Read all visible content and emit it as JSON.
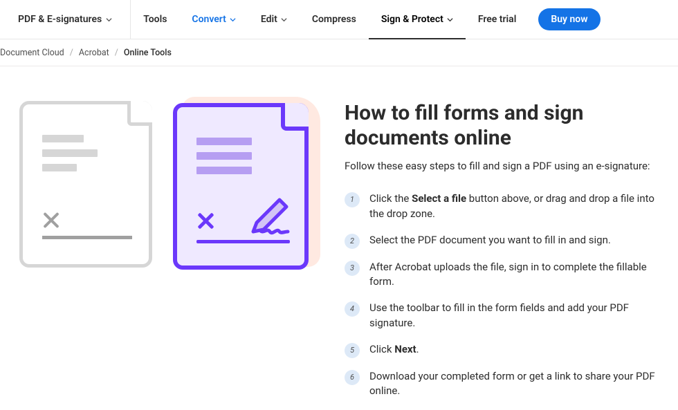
{
  "nav": {
    "category": "PDF & E-signatures",
    "items": [
      {
        "label": "Tools",
        "dropdown": false
      },
      {
        "label": "Convert",
        "dropdown": true,
        "highlight": true
      },
      {
        "label": "Edit",
        "dropdown": true
      },
      {
        "label": "Compress",
        "dropdown": false
      },
      {
        "label": "Sign & Protect",
        "dropdown": true,
        "active": true
      },
      {
        "label": "Free trial",
        "dropdown": false
      }
    ],
    "buy": "Buy now"
  },
  "breadcrumbs": [
    "Document Cloud",
    "Acrobat",
    "Online Tools"
  ],
  "heading": "How to fill forms and sign documents online",
  "subheading": "Follow these easy steps to fill and sign a PDF using an e-signature:",
  "steps": [
    {
      "pre": "Click the ",
      "bold": "Select a file",
      "post": " button above, or drag and drop a file into the drop zone."
    },
    {
      "pre": "Select the PDF document you want to fill in and sign.",
      "bold": "",
      "post": ""
    },
    {
      "pre": "After Acrobat uploads the file, sign in to complete the fillable form.",
      "bold": "",
      "post": ""
    },
    {
      "pre": "Use the toolbar to fill in the form fields and add your PDF signature.",
      "bold": "",
      "post": ""
    },
    {
      "pre": "Click ",
      "bold": "Next",
      "post": "."
    },
    {
      "pre": "Download your completed form or get a link to share your PDF online.",
      "bold": "",
      "post": ""
    }
  ]
}
